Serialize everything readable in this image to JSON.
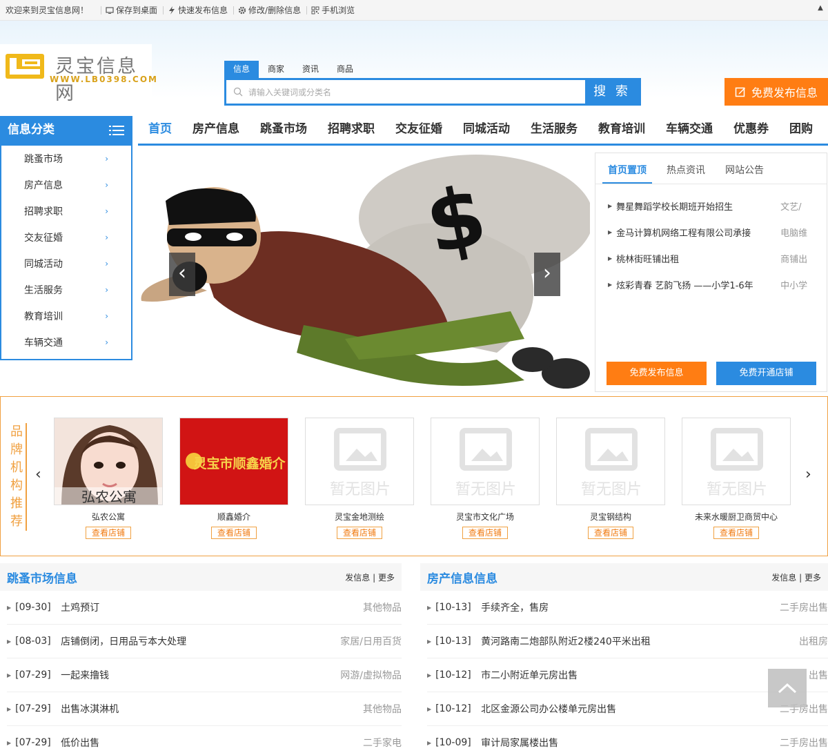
{
  "topbar": {
    "welcome": "欢迎来到灵宝信息网！",
    "save_desktop": "保存到桌面",
    "quick_publish": "快速发布信息",
    "edit_delete": "修改/删除信息",
    "mobile": "手机浏览"
  },
  "logo": {
    "name": "灵宝信息网",
    "url": "WWW.LB0398.COM"
  },
  "search": {
    "tabs": [
      "信息",
      "商家",
      "资讯",
      "商品"
    ],
    "placeholder": "请输入关键词或分类名",
    "button": "搜 索"
  },
  "publish_button": "免费发布信息",
  "category_head": "信息分类",
  "nav": [
    "首页",
    "房产信息",
    "跳蚤市场",
    "招聘求职",
    "交友征婚",
    "同城活动",
    "生活服务",
    "教育培训",
    "车辆交通",
    "优惠券",
    "团购"
  ],
  "sidebar": [
    "跳蚤市场",
    "房产信息",
    "招聘求职",
    "交友征婚",
    "同城活动",
    "生活服务",
    "教育培训",
    "车辆交通"
  ],
  "notice": {
    "tabs": [
      "首页置顶",
      "热点资讯",
      "网站公告"
    ],
    "items": [
      {
        "title": "舞星舞蹈学校长期班开始招生",
        "cat": "文艺/"
      },
      {
        "title": "金马计算机网络工程有限公司承接",
        "cat": "电脑维"
      },
      {
        "title": "桃林街旺铺出租",
        "cat": "商铺出"
      },
      {
        "title": "炫彩青春 艺韵飞扬 ——小学1-6年",
        "cat": "中小学"
      }
    ],
    "btn_publish": "免费发布信息",
    "btn_shop": "免费开通店铺"
  },
  "brands": {
    "title": "品牌机构推荐",
    "view_label": "查看店铺",
    "no_image": "暂无图片",
    "items": [
      {
        "name": "弘农公寓",
        "img_text": "弘农公寓"
      },
      {
        "name": "顺鑫婚介",
        "img_text": "灵宝市顺鑫婚介"
      },
      {
        "name": "灵宝金地测绘"
      },
      {
        "name": "灵宝市文化广场"
      },
      {
        "name": "灵宝钢结构"
      },
      {
        "name": "未来水暖厨卫商贸中心"
      }
    ]
  },
  "flea": {
    "title": "跳蚤市场信息",
    "post": "发信息",
    "more": "更多",
    "rows": [
      {
        "date": "[09-30]",
        "title": "土鸡预订",
        "cat": "其他物品"
      },
      {
        "date": "[08-03]",
        "title": "店铺倒闭，日用品亏本大处理",
        "cat": "家居/日用百货"
      },
      {
        "date": "[07-29]",
        "title": "一起来撸钱",
        "cat": "网游/虚拟物品"
      },
      {
        "date": "[07-29]",
        "title": "出售冰淇淋机",
        "cat": "其他物品"
      },
      {
        "date": "[07-29]",
        "title": "低价出售",
        "cat": "二手家电"
      }
    ]
  },
  "house": {
    "title": "房产信息信息",
    "post": "发信息",
    "more": "更多",
    "rows": [
      {
        "date": "[10-13]",
        "title": "手续齐全，售房",
        "cat": "二手房出售"
      },
      {
        "date": "[10-13]",
        "title": "黄河路南二炮部队附近2楼240平米出租",
        "cat": "出租房"
      },
      {
        "date": "[10-12]",
        "title": "市二小附近单元房出售",
        "cat": "出售"
      },
      {
        "date": "[10-12]",
        "title": "北区金源公司办公楼单元房出售",
        "cat": "二手房出售"
      },
      {
        "date": "[10-09]",
        "title": "审计局家属楼出售",
        "cat": "二手房出售"
      }
    ]
  },
  "colors": {
    "primary": "#2b8be0",
    "accent": "#ff7d13"
  }
}
